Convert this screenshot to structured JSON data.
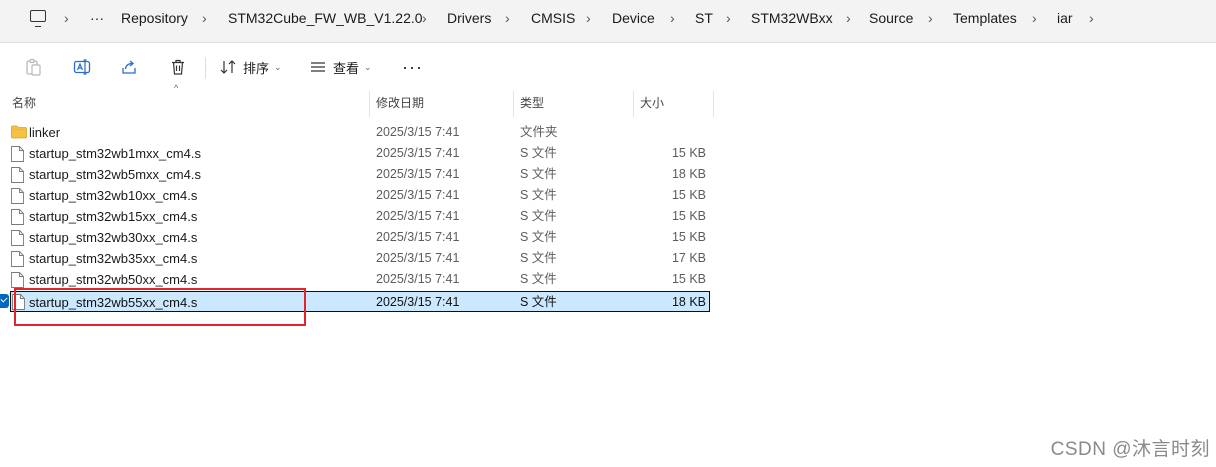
{
  "breadcrumb": {
    "more": "···",
    "items": [
      "Repository",
      "STM32Cube_FW_WB_V1.22.0",
      "Drivers",
      "CMSIS",
      "Device",
      "ST",
      "STM32WBxx",
      "Source",
      "Templates",
      "iar"
    ]
  },
  "toolbar": {
    "sort_label": "排序",
    "view_label": "查看",
    "more_label": "···"
  },
  "columns": {
    "name": "名称",
    "modified": "修改日期",
    "type": "类型",
    "size": "大小"
  },
  "files": [
    {
      "name": "linker",
      "modified": "2025/3/15 7:41",
      "type": "文件夹",
      "size": "",
      "icon": "folder-icon"
    },
    {
      "name": "startup_stm32wb1mxx_cm4.s",
      "modified": "2025/3/15 7:41",
      "type": "S 文件",
      "size": "15 KB",
      "icon": "file-icon"
    },
    {
      "name": "startup_stm32wb5mxx_cm4.s",
      "modified": "2025/3/15 7:41",
      "type": "S 文件",
      "size": "18 KB",
      "icon": "file-icon"
    },
    {
      "name": "startup_stm32wb10xx_cm4.s",
      "modified": "2025/3/15 7:41",
      "type": "S 文件",
      "size": "15 KB",
      "icon": "file-icon"
    },
    {
      "name": "startup_stm32wb15xx_cm4.s",
      "modified": "2025/3/15 7:41",
      "type": "S 文件",
      "size": "15 KB",
      "icon": "file-icon"
    },
    {
      "name": "startup_stm32wb30xx_cm4.s",
      "modified": "2025/3/15 7:41",
      "type": "S 文件",
      "size": "15 KB",
      "icon": "file-icon"
    },
    {
      "name": "startup_stm32wb35xx_cm4.s",
      "modified": "2025/3/15 7:41",
      "type": "S 文件",
      "size": "17 KB",
      "icon": "file-icon"
    },
    {
      "name": "startup_stm32wb50xx_cm4.s",
      "modified": "2025/3/15 7:41",
      "type": "S 文件",
      "size": "15 KB",
      "icon": "file-icon"
    },
    {
      "name": "startup_stm32wb55xx_cm4.s",
      "modified": "2025/3/15 7:41",
      "type": "S 文件",
      "size": "18 KB",
      "icon": "file-icon"
    }
  ],
  "watermark": "CSDN @沐言时刻",
  "colors": {
    "selection": "#cce8ff",
    "highlight_box": "#e2252b",
    "accent": "#0067c0",
    "folder": "#f4c145"
  }
}
